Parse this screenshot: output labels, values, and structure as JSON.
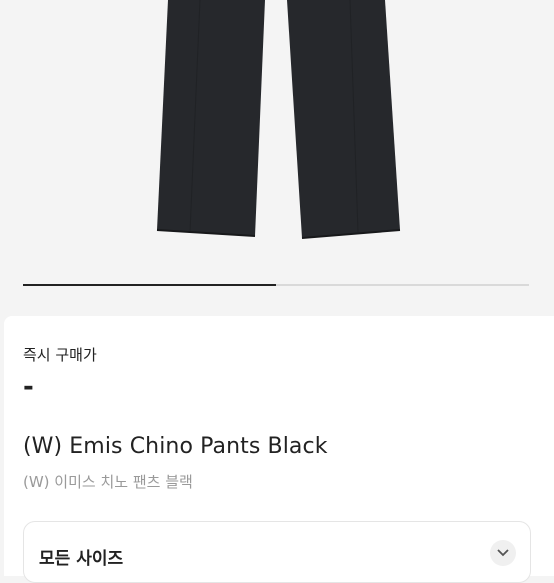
{
  "product": {
    "buy_now_label": "즉시 구매가",
    "price": "-",
    "name_en": "(W) Emis Chino Pants Black",
    "name_ko": "(W) 이미스 치노 팬츠 블랙"
  },
  "carousel": {
    "progress": 0.5
  },
  "size_selector": {
    "label": "모든 사이즈",
    "icon": "chevron-down-icon"
  }
}
